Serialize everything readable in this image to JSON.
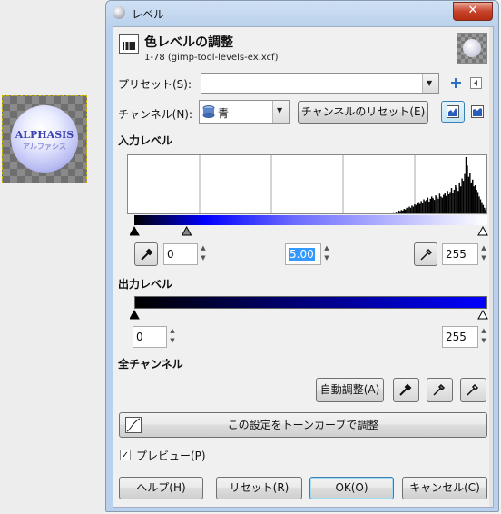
{
  "canvas": {
    "logo_text": "ALPHASIS",
    "logo_sub": "アルファシス"
  },
  "window": {
    "title": "レベル",
    "close_label": "✕"
  },
  "header": {
    "title": "色レベルの調整",
    "subtitle": "1-78 (gimp-tool-levels-ex.xcf)"
  },
  "preset": {
    "label": "プリセット(S):",
    "value": ""
  },
  "channel": {
    "label": "チャンネル(N):",
    "value": "青",
    "reset_label": "チャンネルのリセット(E)"
  },
  "input_levels": {
    "heading": "入力レベル",
    "low": "0",
    "gamma": "5.00",
    "high": "255",
    "histogram_bins": [
      0,
      0,
      0,
      0,
      0,
      0,
      0,
      0,
      0,
      0,
      0,
      0,
      0,
      0,
      0,
      0,
      0,
      0,
      0,
      0,
      0,
      0,
      0,
      0,
      0,
      0,
      0,
      0,
      0,
      0,
      0,
      0,
      0,
      0,
      0,
      0,
      0,
      0,
      0,
      0,
      0,
      0,
      0,
      0,
      0,
      0,
      0,
      0,
      0,
      0,
      0,
      0,
      0,
      0,
      0,
      0,
      0,
      0,
      0,
      0,
      0,
      0,
      0,
      0,
      0,
      0,
      0,
      0,
      0,
      0,
      0,
      0,
      0,
      0,
      0,
      0,
      0,
      0,
      0,
      0,
      0,
      0,
      0,
      0,
      0,
      0,
      0,
      0,
      0,
      0,
      0,
      0,
      0,
      0,
      0,
      0,
      0,
      0,
      0,
      0,
      0,
      0,
      0,
      0,
      0,
      0,
      0,
      0,
      0,
      0,
      0,
      0,
      0,
      0,
      0,
      0,
      0,
      0,
      0,
      0,
      0,
      0,
      0,
      0,
      0,
      0,
      0,
      0,
      0,
      0,
      0,
      0,
      0,
      0,
      0,
      0,
      0,
      0,
      0,
      0,
      0,
      0,
      0,
      0,
      0,
      0,
      0,
      0,
      0,
      0,
      0,
      0,
      0,
      0,
      0,
      0,
      0,
      0,
      0,
      0,
      0,
      0,
      0,
      0,
      0,
      0,
      0,
      0,
      0,
      0,
      0,
      0,
      0,
      0,
      0,
      0,
      0,
      0,
      0,
      0,
      0,
      0,
      0,
      0,
      0,
      0,
      0,
      0,
      0,
      0,
      0,
      0,
      0,
      0,
      0,
      0,
      0,
      0,
      0,
      0,
      0.01,
      0.02,
      0.01,
      0.03,
      0.02,
      0.05,
      0.04,
      0.06,
      0.05,
      0.08,
      0.07,
      0.1,
      0.09,
      0.12,
      0.1,
      0.14,
      0.12,
      0.16,
      0.15,
      0.18,
      0.2,
      0.17,
      0.22,
      0.19,
      0.25,
      0.22,
      0.24,
      0.28,
      0.21,
      0.26,
      0.3,
      0.27,
      0.24,
      0.32,
      0.29,
      0.26,
      0.35,
      0.3,
      0.28,
      0.33,
      0.36,
      0.31,
      0.4,
      0.34,
      0.38,
      0.45,
      0.36,
      0.42,
      0.5,
      0.46,
      0.4,
      0.55,
      0.48,
      0.62,
      0.58,
      0.7,
      1.0,
      0.85,
      0.65,
      0.72,
      0.55,
      0.6,
      0.48,
      0.5,
      0.42,
      0.38,
      0.3,
      0.25,
      0.2,
      0.15,
      0.1,
      0.06
    ],
    "low_handle": 0,
    "gamma_handle": 0.15,
    "high_handle": 1.0
  },
  "output_levels": {
    "heading": "出力レベル",
    "low": "0",
    "high": "255"
  },
  "all_channels": {
    "heading": "全チャンネル",
    "auto_label": "自動調整(A)",
    "curves_label": "この設定をトーンカーブで調整"
  },
  "preview": {
    "label": "プレビュー(P)",
    "checked": "✓"
  },
  "buttons": {
    "help": "ヘルプ(H)",
    "reset": "リセット(R)",
    "ok": "OK(O)",
    "cancel": "キャンセル(C)"
  },
  "colors": {
    "accent_blue": "#0000ff",
    "selection": "#3399ff"
  }
}
